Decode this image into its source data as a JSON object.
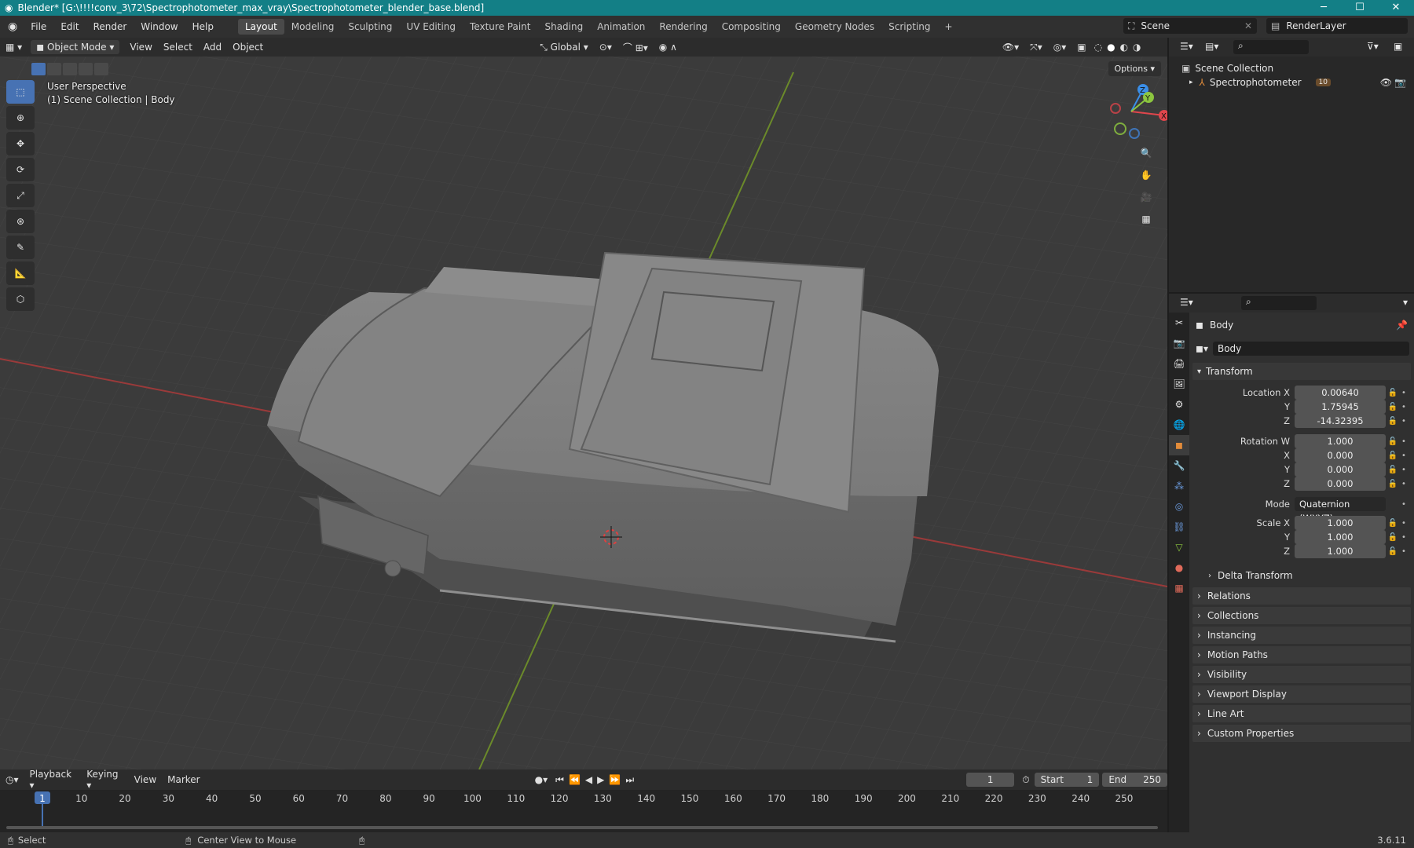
{
  "window": {
    "title": "Blender* [G:\\!!!!conv_3\\72\\Spectrophotometer_max_vray\\Spectrophotometer_blender_base.blend]",
    "minimize": "─",
    "maximize": "☐",
    "close": "✕"
  },
  "menu": {
    "items": [
      "File",
      "Edit",
      "Render",
      "Window",
      "Help"
    ],
    "workspaces": [
      "Layout",
      "Modeling",
      "Sculpting",
      "UV Editing",
      "Texture Paint",
      "Shading",
      "Animation",
      "Rendering",
      "Compositing",
      "Geometry Nodes",
      "Scripting"
    ],
    "active_workspace": "Layout",
    "add_workspace": "+",
    "scene": "Scene",
    "view_layer": "RenderLayer"
  },
  "viewport_header": {
    "mode": "Object Mode",
    "menus": [
      "View",
      "Select",
      "Add",
      "Object"
    ],
    "orientation": "Global",
    "options": "Options"
  },
  "viewport": {
    "perspective": "User Perspective",
    "context": "(1) Scene Collection | Body",
    "gizmo": {
      "x": "X",
      "y": "Y",
      "z": "Z"
    }
  },
  "outliner": {
    "root": "Scene Collection",
    "items": [
      {
        "name": "Spectrophotometer",
        "count": "10"
      }
    ]
  },
  "properties": {
    "object_name": "Body",
    "data_name": "Body",
    "transform_title": "Transform",
    "location": {
      "label_x": "Location X",
      "label_y": "Y",
      "label_z": "Z",
      "x": "0.00640",
      "y": "1.75945",
      "z": "-14.32395"
    },
    "rotation": {
      "label_w": "Rotation W",
      "label_x": "X",
      "label_y": "Y",
      "label_z": "Z",
      "w": "1.000",
      "x": "0.000",
      "y": "0.000",
      "z": "0.000"
    },
    "mode_label": "Mode",
    "mode_value": "Quaternion (WXYZ)",
    "scale": {
      "label_x": "Scale X",
      "label_y": "Y",
      "label_z": "Z",
      "x": "1.000",
      "y": "1.000",
      "z": "1.000"
    },
    "delta": "Delta Transform",
    "panels": [
      "Relations",
      "Collections",
      "Instancing",
      "Motion Paths",
      "Visibility",
      "Viewport Display",
      "Line Art",
      "Custom Properties"
    ]
  },
  "timeline": {
    "menus": [
      "Playback",
      "Keying",
      "View",
      "Marker"
    ],
    "current_frame": "1",
    "start_label": "Start",
    "start": "1",
    "end_label": "End",
    "end": "250",
    "ticks": [
      "1",
      "10",
      "20",
      "30",
      "40",
      "50",
      "60",
      "70",
      "80",
      "90",
      "100",
      "110",
      "120",
      "130",
      "140",
      "150",
      "160",
      "170",
      "180",
      "190",
      "200",
      "210",
      "220",
      "230",
      "240",
      "250"
    ]
  },
  "status": {
    "select": "Select",
    "center_view": "Center View to Mouse",
    "version": "3.6.11"
  },
  "colors": {
    "accent": "#4772b3",
    "titlebar": "#137f86",
    "x_axis": "#e0464c",
    "y_axis": "#8cc63f",
    "z_axis": "#3a8ee8"
  }
}
